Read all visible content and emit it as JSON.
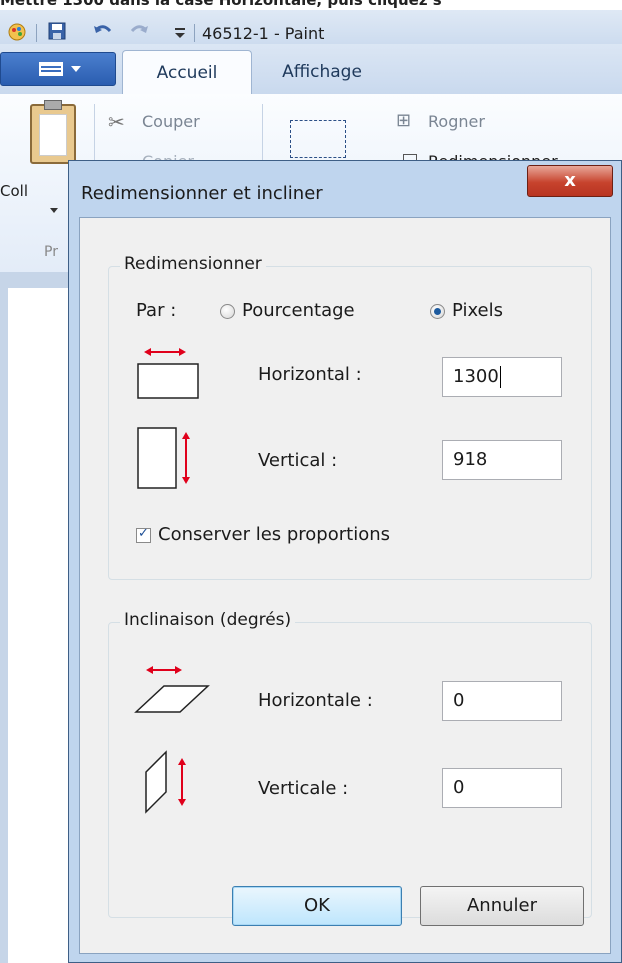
{
  "top_caption": "Mettre 1300 dans la case Horizontale, puis cliquez s",
  "window": {
    "title": "46512-1 - Paint"
  },
  "ribbon": {
    "tabs": [
      "Accueil",
      "Affichage"
    ],
    "active_tab": "Accueil",
    "paste_label": "Coll",
    "group_label": "Pr",
    "cut_label": "Couper",
    "copy_label": "Copier",
    "crop_label": "Rogner",
    "resize_label": "Redimensionner"
  },
  "dialog": {
    "title": "Redimensionner et incliner",
    "close_label": "x",
    "resize_group": {
      "label": "Redimensionner",
      "by_label": "Par :",
      "option_percent": "Pourcentage",
      "option_pixels": "Pixels",
      "selected": "Pixels",
      "horizontal_label": "Horizontal :",
      "horizontal_value": "1300",
      "vertical_label": "Vertical :",
      "vertical_value": "918",
      "keep_ratio_label": "Conserver les proportions",
      "keep_ratio_checked": true
    },
    "skew_group": {
      "label": "Inclinaison (degrés)",
      "horizontal_label": "Horizontale :",
      "horizontal_value": "0",
      "vertical_label": "Verticale :",
      "vertical_value": "0"
    },
    "ok_label": "OK",
    "cancel_label": "Annuler"
  },
  "colors": {
    "arrow": "#e0001b",
    "title_bar": "#cddcef",
    "dialog_frame": "#bfd5ee",
    "close_button": "#c7432d"
  }
}
